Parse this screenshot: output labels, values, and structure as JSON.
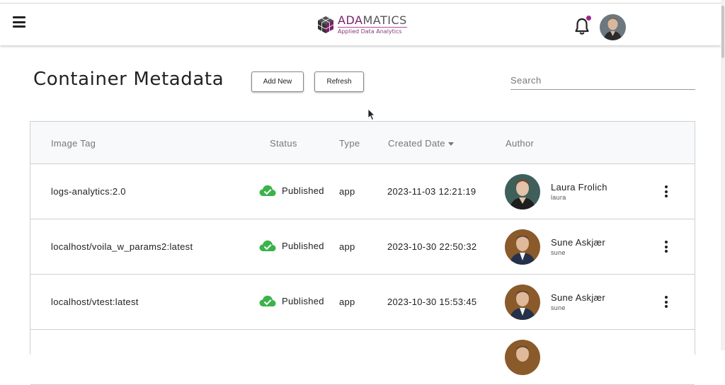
{
  "header": {
    "logo_brand_a": "ADA",
    "logo_brand_b": "MATICS",
    "logo_tagline": "Applied Data Analytics",
    "notification_dot": true
  },
  "page": {
    "title": "Container Metadata",
    "add_new_label": "Add New",
    "refresh_label": "Refresh",
    "search_placeholder": "Search"
  },
  "table": {
    "columns": {
      "image_tag": "Image Tag",
      "status": "Status",
      "type": "Type",
      "created_date": "Created Date",
      "author": "Author"
    },
    "rows": [
      {
        "image_tag": "logs-analytics:2.0",
        "status": "Published",
        "type": "app",
        "created_date": "2023-11-03 12:21:19",
        "author_name": "Laura Frolich",
        "author_user": "laura"
      },
      {
        "image_tag": "localhost/voila_w_params2:latest",
        "status": "Published",
        "type": "app",
        "created_date": "2023-10-30 22:50:32",
        "author_name": "Sune Askjær",
        "author_user": "sune"
      },
      {
        "image_tag": "localhost/vtest:latest",
        "status": "Published",
        "type": "app",
        "created_date": "2023-10-30 15:53:45",
        "author_name": "Sune Askjær",
        "author_user": "sune"
      }
    ]
  },
  "colors": {
    "published_green": "#3cb34a",
    "brand_purple": "#9c2a8c"
  }
}
